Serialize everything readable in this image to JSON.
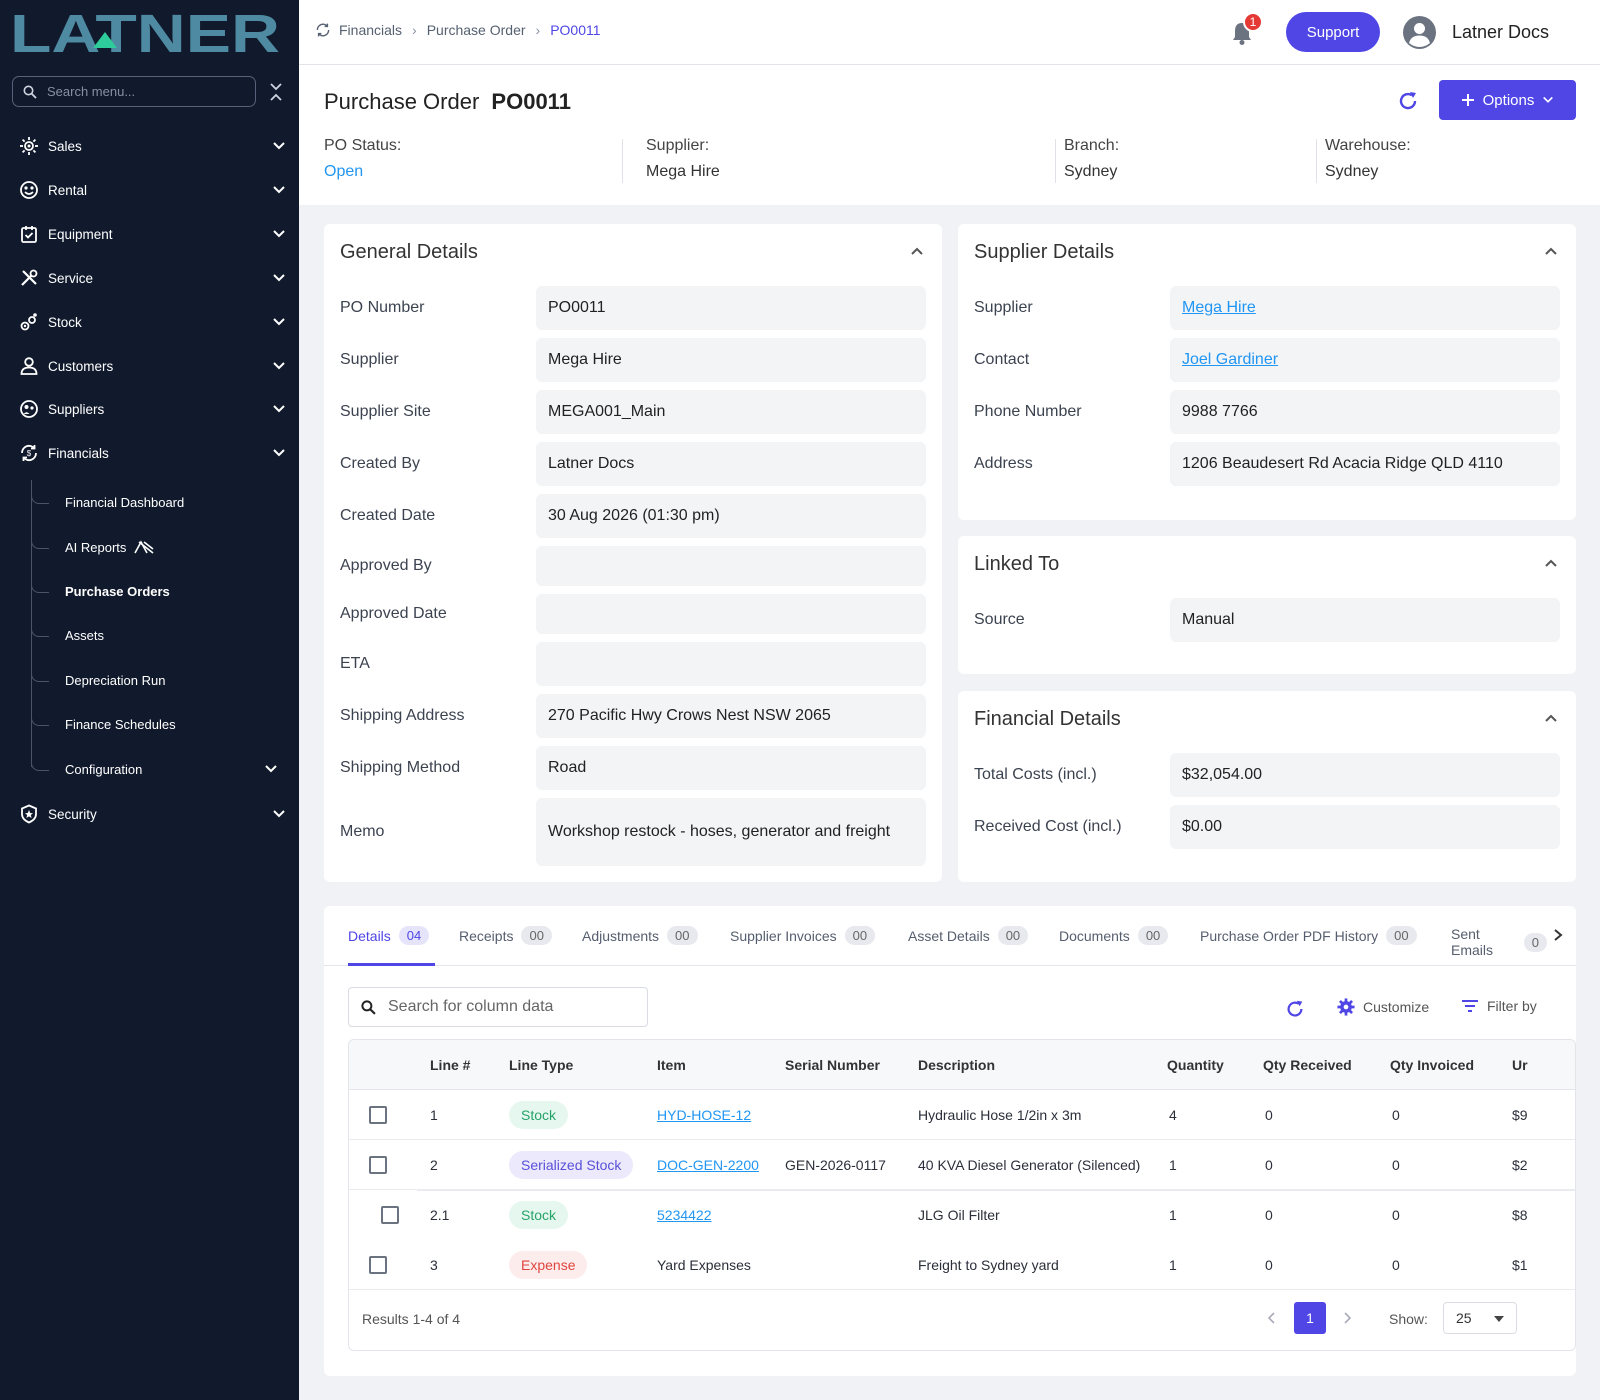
{
  "brand": {
    "logo_text": "LATNER"
  },
  "sidebar": {
    "search_placeholder": "Search menu...",
    "items": [
      {
        "label": "Sales",
        "icon": "sales-icon"
      },
      {
        "label": "Rental",
        "icon": "rental-icon"
      },
      {
        "label": "Equipment",
        "icon": "equipment-icon"
      },
      {
        "label": "Service",
        "icon": "service-icon"
      },
      {
        "label": "Stock",
        "icon": "stock-icon"
      },
      {
        "label": "Customers",
        "icon": "customers-icon"
      },
      {
        "label": "Suppliers",
        "icon": "suppliers-icon"
      },
      {
        "label": "Financials",
        "icon": "financials-icon"
      },
      {
        "label": "Security",
        "icon": "security-icon"
      }
    ],
    "financials_sub": [
      {
        "label": "Financial Dashboard"
      },
      {
        "label": "AI Reports"
      },
      {
        "label": "Purchase Orders"
      },
      {
        "label": "Assets"
      },
      {
        "label": "Depreciation Run"
      },
      {
        "label": "Finance Schedules"
      },
      {
        "label": "Configuration"
      }
    ]
  },
  "topbar": {
    "breadcrumb": [
      "Financials",
      "Purchase Order",
      "PO0011"
    ],
    "notification_count": "1",
    "support_label": "Support",
    "user_name": "Latner Docs"
  },
  "header": {
    "title_prefix": "Purchase Order",
    "po_number": "PO0011",
    "options_label": "Options",
    "status_label": "PO Status:",
    "status_value": "Open",
    "supplier_label": "Supplier:",
    "supplier_value": "Mega Hire",
    "branch_label": "Branch:",
    "branch_value": "Sydney",
    "warehouse_label": "Warehouse:",
    "warehouse_value": "Sydney"
  },
  "general": {
    "title": "General Details",
    "fields": [
      {
        "label": "PO Number",
        "value": "PO0011"
      },
      {
        "label": "Supplier",
        "value": "Mega Hire"
      },
      {
        "label": "Supplier Site",
        "value": "MEGA001_Main"
      },
      {
        "label": "Created By",
        "value": "Latner Docs"
      },
      {
        "label": "Created Date",
        "value": "30 Aug 2026 (01:30 pm)"
      },
      {
        "label": "Approved By",
        "value": ""
      },
      {
        "label": "Approved Date",
        "value": ""
      },
      {
        "label": "ETA",
        "value": ""
      },
      {
        "label": "Shipping Address",
        "value": "270 Pacific Hwy Crows Nest NSW 2065"
      },
      {
        "label": "Shipping Method",
        "value": "Road"
      },
      {
        "label": "Memo",
        "value": "Workshop restock - hoses, generator and freight"
      }
    ]
  },
  "supplier_details": {
    "title": "Supplier Details",
    "fields": [
      {
        "label": "Supplier",
        "value": "Mega Hire"
      },
      {
        "label": "Contact",
        "value": "Joel Gardiner"
      },
      {
        "label": "Phone Number",
        "value": "9988 7766"
      },
      {
        "label": "Address",
        "value": "1206 Beaudesert Rd Acacia Ridge QLD 4110"
      }
    ]
  },
  "linked_to": {
    "title": "Linked To",
    "fields": [
      {
        "label": "Source",
        "value": "Manual"
      }
    ]
  },
  "financial_details": {
    "title": "Financial Details",
    "fields": [
      {
        "label": "Total Costs (incl.)",
        "value": "$32,054.00"
      },
      {
        "label": "Received Cost (incl.)",
        "value": "$0.00"
      }
    ]
  },
  "tabs": [
    {
      "label": "Details",
      "count": "04"
    },
    {
      "label": "Receipts",
      "count": "00"
    },
    {
      "label": "Adjustments",
      "count": "00"
    },
    {
      "label": "Supplier Invoices",
      "count": "00"
    },
    {
      "label": "Asset Details",
      "count": "00"
    },
    {
      "label": "Documents",
      "count": "00"
    },
    {
      "label": "Purchase Order PDF History",
      "count": "00"
    },
    {
      "label": "Sent Emails",
      "count": "0"
    }
  ],
  "table": {
    "search_placeholder": "Search for column data",
    "customize_label": "Customize",
    "filter_label": "Filter by",
    "columns": [
      "Line #",
      "Line Type",
      "Item",
      "Serial Number",
      "Description",
      "Quantity",
      "Qty Received",
      "Qty Invoiced",
      "Ur"
    ],
    "rows": [
      {
        "line": "1",
        "type": "Stock",
        "item": "HYD-HOSE-12",
        "serial": "",
        "description": "Hydraulic Hose 1/2in x 3m",
        "quantity": "4",
        "qty_received": "0",
        "qty_invoiced": "0",
        "unit": "$9"
      },
      {
        "line": "2",
        "type": "Serialized Stock",
        "item": "DOC-GEN-2200",
        "serial": "GEN-2026-0117",
        "description": "40 KVA Diesel Generator (Silenced)",
        "quantity": "1",
        "qty_received": "0",
        "qty_invoiced": "0",
        "unit": "$2"
      },
      {
        "line": "2.1",
        "type": "Stock",
        "item": "5234422",
        "serial": "",
        "description": "JLG Oil Filter",
        "quantity": "1",
        "qty_received": "0",
        "qty_invoiced": "0",
        "unit": "$8"
      },
      {
        "line": "3",
        "type": "Expense",
        "item": "Yard Expenses",
        "serial": "",
        "description": "Freight to Sydney yard",
        "quantity": "1",
        "qty_received": "0",
        "qty_invoiced": "0",
        "unit": "$1"
      }
    ],
    "results_text": "Results 1-4 of 4",
    "current_page": "1",
    "show_label": "Show:",
    "page_size": "25"
  },
  "colors": {
    "accent": "#4f46e5",
    "sidebar_bg": "#111a2c",
    "link": "#2196f3",
    "logo": "#4f8aa3"
  }
}
